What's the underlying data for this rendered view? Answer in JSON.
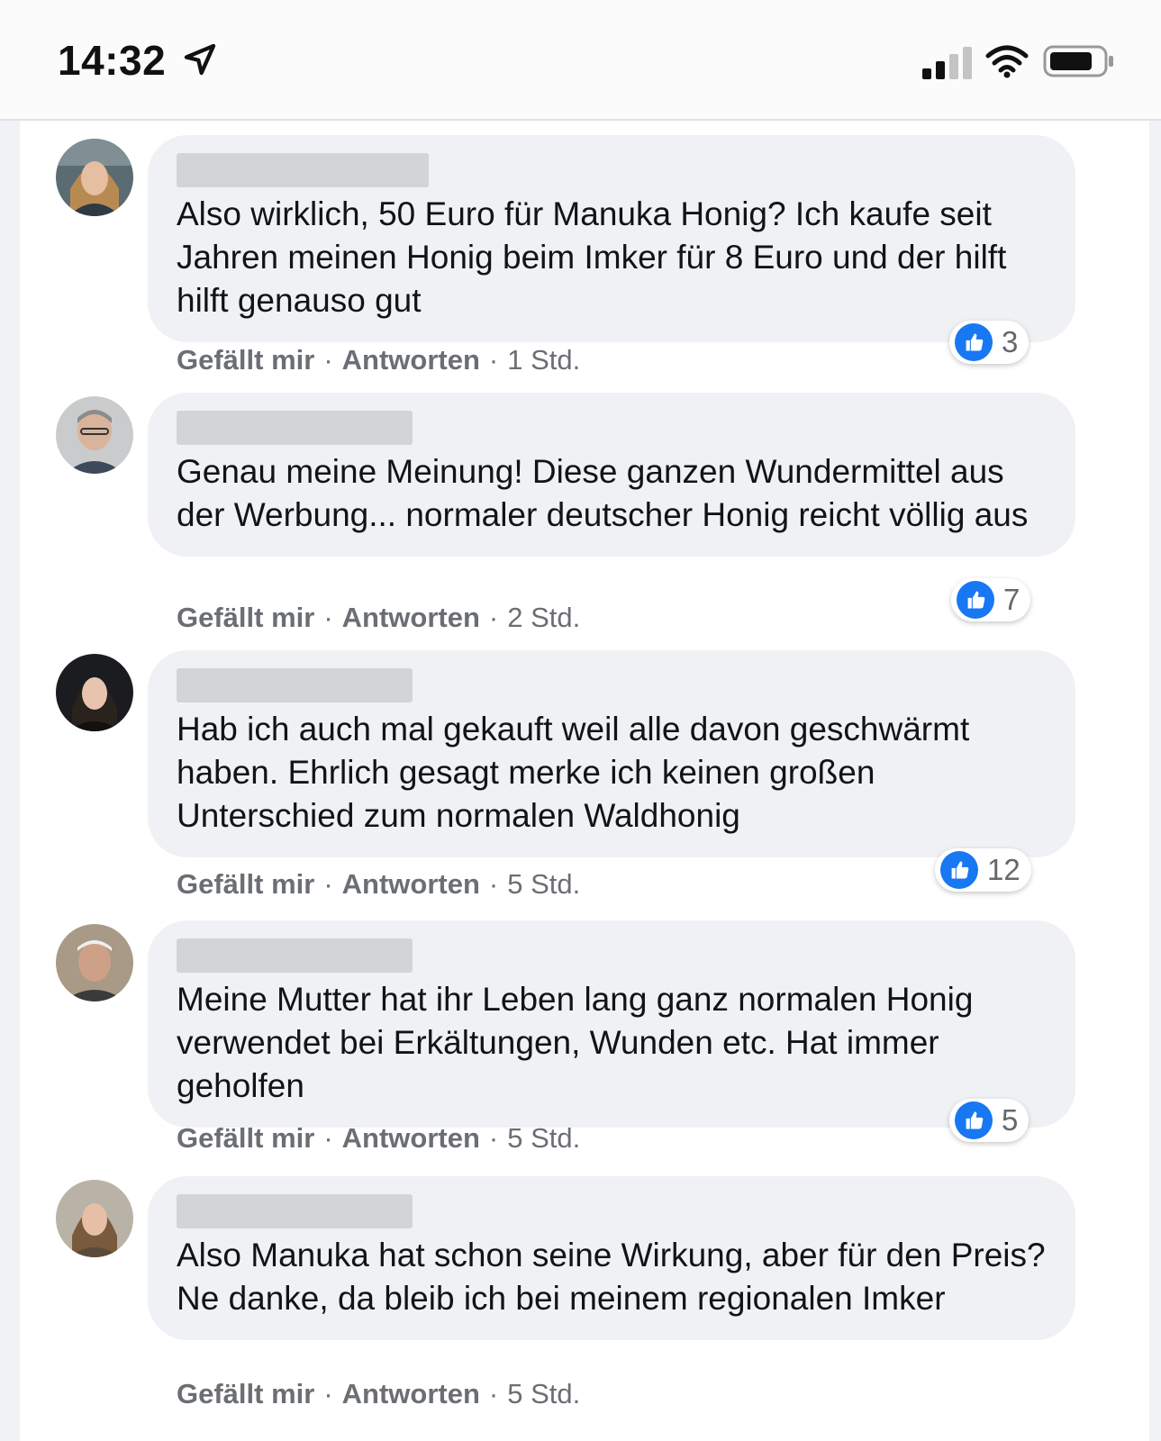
{
  "status_bar": {
    "time": "14:32",
    "icons": [
      "location-arrow-icon",
      "cellular-signal-icon",
      "wifi-icon",
      "battery-icon"
    ]
  },
  "colors": {
    "like_blue": "#1877f2",
    "bubble_bg": "#eff1f4",
    "meta_text": "#6b6e73"
  },
  "comments": [
    {
      "text": "Also wirklich, 50 Euro für Manuka Honig? Ich kaufe seit Jahren meinen Honig beim Imker für 8 Euro und der hilft hilft genauso gut",
      "like_label": "Gefällt mir",
      "reply_label": "Antworten",
      "time": "1 Std.",
      "reactions": "3"
    },
    {
      "text": "Genau meine Meinung! Diese ganzen Wundermittel aus der Werbung... normaler deutscher Honig reicht völlig aus",
      "like_label": "Gefällt mir",
      "reply_label": "Antworten",
      "time": "2 Std.",
      "reactions": "7"
    },
    {
      "text": "Hab ich auch mal gekauft weil alle davon geschwärmt haben. Ehrlich gesagt merke ich keinen großen Unterschied zum normalen Waldhonig",
      "like_label": "Gefällt mir",
      "reply_label": "Antworten",
      "time": "5 Std.",
      "reactions": "12"
    },
    {
      "text": "Meine Mutter hat ihr Leben lang ganz normalen Honig verwendet bei Erkältungen, Wunden etc. Hat immer geholfen",
      "like_label": "Gefällt mir",
      "reply_label": "Antworten",
      "time": "5 Std.",
      "reactions": "5"
    },
    {
      "text": "Also Manuka hat schon seine Wirkung, aber für den Preis? Ne danke, da bleib ich bei meinem regionalen Imker",
      "like_label": "Gefällt mir",
      "reply_label": "Antworten",
      "time": "5 Std."
    }
  ]
}
